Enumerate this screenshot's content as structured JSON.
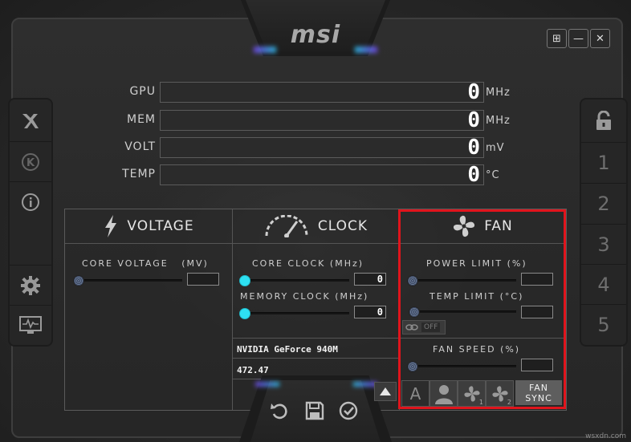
{
  "app": {
    "logo": "msi",
    "watermark": "wsxdn.com"
  },
  "window_buttons": [
    {
      "icon": "windows-icon",
      "label": "⊞"
    },
    {
      "icon": "minimize-icon",
      "label": "—"
    },
    {
      "icon": "close-icon",
      "label": "✕"
    }
  ],
  "left_sidebar": {
    "items": [
      {
        "icon": "kombustor-icon"
      },
      {
        "icon": "k-boost-icon",
        "label": "K"
      },
      {
        "icon": "info-icon",
        "label": "i"
      },
      {
        "icon": "settings-gear-icon"
      },
      {
        "icon": "monitoring-icon"
      }
    ]
  },
  "right_sidebar": {
    "lock_icon": "lock-icon",
    "profiles": [
      "1",
      "2",
      "3",
      "4",
      "5"
    ]
  },
  "monitor": [
    {
      "label": "GPU",
      "value": "0",
      "unit": "MHz"
    },
    {
      "label": "MEM",
      "value": "0",
      "unit": "MHz"
    },
    {
      "label": "VOLT",
      "value": "0",
      "unit": "mV"
    },
    {
      "label": "TEMP",
      "value": "0",
      "unit": "°C"
    }
  ],
  "voltage": {
    "title": "VOLTAGE",
    "core_voltage_label": "CORE VOLTAGE",
    "core_voltage_unit": "(MV)",
    "core_voltage_value": ""
  },
  "clock": {
    "title": "CLOCK",
    "core_clock_label": "CORE CLOCK",
    "core_clock_unit": "(MHz)",
    "core_clock_value": "0",
    "memory_clock_label": "MEMORY CLOCK",
    "memory_clock_unit": "(MHz)",
    "memory_clock_value": "0",
    "gpu_name": "NVIDIA GeForce 940M",
    "driver_version": "472.47"
  },
  "fan": {
    "title": "FAN",
    "power_limit_label": "POWER LIMIT",
    "power_limit_unit": "(%)",
    "power_limit_value": "",
    "temp_limit_label": "TEMP LIMIT",
    "temp_limit_unit": "(°C)",
    "temp_limit_value": "",
    "link_toggle": "OFF",
    "fan_speed_label": "FAN SPEED",
    "fan_speed_unit": "(%)",
    "fan_speed_value": "",
    "fan_buttons": [
      "A",
      "user",
      "1",
      "2"
    ],
    "fan_sync_line1": "FAN",
    "fan_sync_line2": "SYNC"
  },
  "actions": {
    "reset_icon": "reset-icon",
    "save_icon": "save-icon",
    "apply_icon": "apply-check-icon",
    "expand_icon": "triangle-up-icon"
  },
  "colors": {
    "accent_cyan": "#2ee0f2",
    "highlight_red": "#e0141c"
  }
}
